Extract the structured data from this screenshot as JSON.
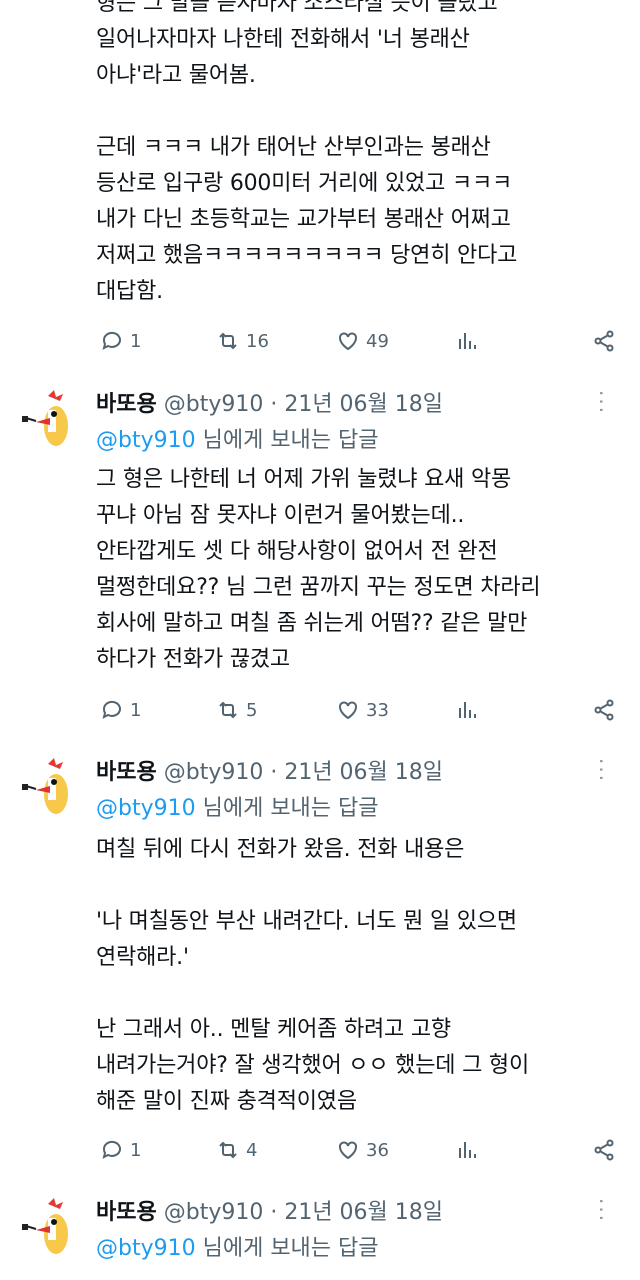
{
  "top_tweet": {
    "text": "형은 그 말을 듣자마자 소스라칠 듯이 놀랐고\n일어나자마자 나한테 전화해서 '너 봉래산\n아냐'라고 물어봄.\n\n근데 ㅋㅋㅋ 내가 태어난 산부인과는 봉래산\n등산로 입구랑 600미터 거리에 있었고 ㅋㅋㅋ\n내가 다닌 초등학교는 교가부터 봉래산 어쩌고\n저쩌고 했음ㅋㅋㅋㅋㅋㅋㅋㅋㅋ 당연히 안다고\n대답함.",
    "replies": "1",
    "retweets": "16",
    "likes": "49"
  },
  "tweets": [
    {
      "name": "바또용",
      "handle": "@bty910",
      "date": "· 21년 06월 18일",
      "reply_to": "@bty910",
      "reply_suffix": " 님에게 보내는 답글",
      "text": "그 형은 나한테 너 어제 가위 눌렸냐 요새 악몽\n꾸냐 아님 잠 못자냐 이런거 물어봤는데..\n안타깝게도 셋 다 해당사항이 없어서 전 완전\n멀쩡한데요?? 님 그런 꿈까지 꾸는 정도면 차라리\n회사에 말하고 며칠 좀 쉬는게 어떰?? 같은 말만\n하다가 전화가 끊겼고",
      "replies": "1",
      "retweets": "5",
      "likes": "33"
    },
    {
      "name": "바또용",
      "handle": "@bty910",
      "date": "· 21년 06월 18일",
      "reply_to": "@bty910",
      "reply_suffix": " 님에게 보내는 답글",
      "text": "며칠 뒤에 다시 전화가 왔음. 전화 내용은\n\n'나 며칠동안 부산 내려간다. 너도 뭔 일 있으면\n연락해라.'\n\n난 그래서 아.. 멘탈 케어좀 하려고 고향\n내려가는거야? 잘 생각했어 ㅇㅇ 했는데 그 형이\n해준 말이 진짜 충격적이였음",
      "replies": "1",
      "retweets": "4",
      "likes": "36"
    },
    {
      "name": "바또용",
      "handle": "@bty910",
      "date": "· 21년 06월 18일",
      "reply_to": "@bty910",
      "reply_suffix": " 님에게 보내는 답글",
      "text": "",
      "replies": "",
      "retweets": "",
      "likes": ""
    }
  ],
  "colors": {
    "accent": "#1d9bf0",
    "secondary": "#536471",
    "text": "#0f1419"
  },
  "icons": [
    "reply-icon",
    "retweet-icon",
    "like-icon",
    "analytics-icon",
    "share-icon",
    "more-icon"
  ]
}
